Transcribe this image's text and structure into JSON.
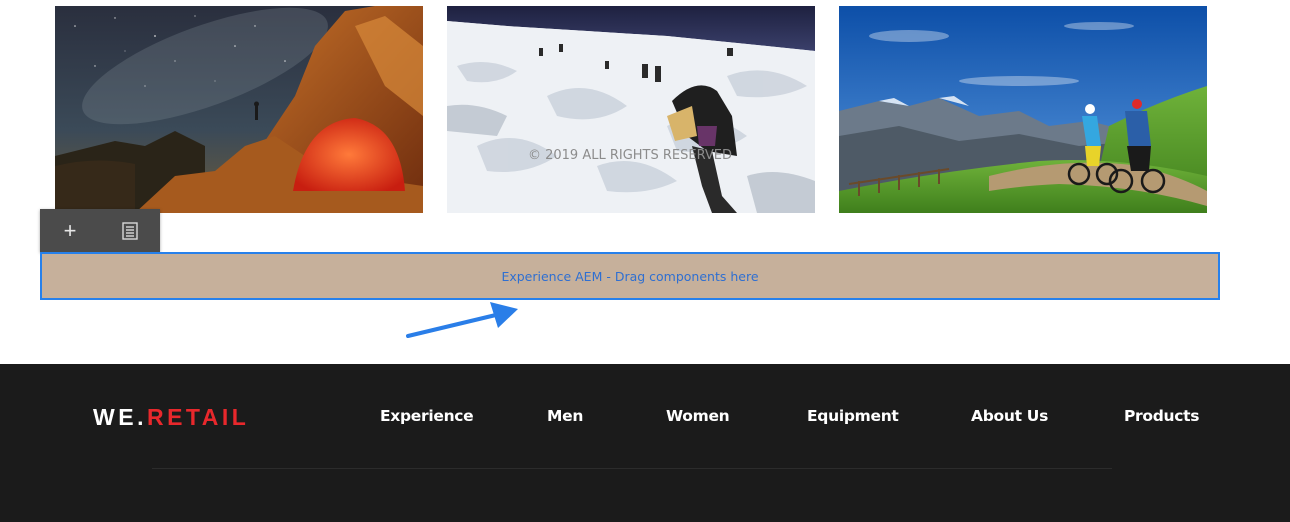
{
  "gallery": {
    "images": [
      {
        "alt": "night-sky-camping"
      },
      {
        "alt": "glacier-climbers"
      },
      {
        "alt": "mountain-bikers"
      }
    ]
  },
  "editor_toolbar": {
    "add_icon": "plus-icon",
    "paste_icon": "paste-icon"
  },
  "dropzone": {
    "label": "Experience AEM - Drag components here"
  },
  "footer": {
    "logo": {
      "we": "WE",
      "dot": ".",
      "retail": "RETAIL",
      "retail_color": "#e8282c"
    },
    "nav": [
      "Experience",
      "Men",
      "Women",
      "Equipment",
      "About Us",
      "Products"
    ],
    "copyright": "© 2019 ALL RIGHTS RESERVED"
  },
  "colors": {
    "accent": "#2680eb",
    "dropzone_bg": "#c6b09b",
    "footer_bg": "#1b1b1b"
  }
}
